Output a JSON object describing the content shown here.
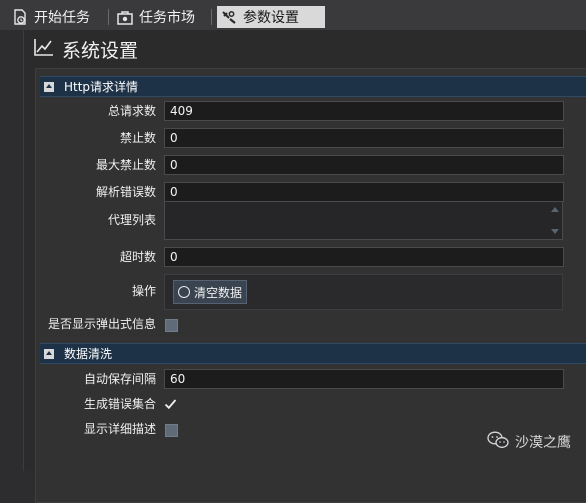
{
  "tabs": [
    {
      "label": "开始任务",
      "icon": "start-task-icon"
    },
    {
      "label": "任务市场",
      "icon": "task-market-icon"
    },
    {
      "label": "参数设置",
      "icon": "settings-icon",
      "active": true
    }
  ],
  "page": {
    "title": "系统设置",
    "title_icon": "chart-line-icon"
  },
  "sections": {
    "http": {
      "title": "Http请求详情",
      "total_requests_label": "总请求数",
      "total_requests_value": "409",
      "banned_label": "禁止数",
      "banned_value": "0",
      "max_banned_label": "最大禁止数",
      "max_banned_value": "0",
      "parse_errors_label": "解析错误数",
      "parse_errors_value": "0",
      "proxy_list_label": "代理列表",
      "timeouts_label": "超时数",
      "timeouts_value": "0",
      "action_label": "操作",
      "clear_button_label": "清空数据",
      "show_popup_label": "是否显示弹出式信息",
      "show_popup_checked": false
    },
    "cleaning": {
      "title": "数据清洗",
      "autosave_label": "自动保存间隔",
      "autosave_value": "60",
      "generate_errors_label": "生成错误集合",
      "generate_errors_checked": true,
      "show_details_label": "显示详细描述",
      "show_details_checked": false
    }
  },
  "watermark": {
    "text": "沙漠之鹰",
    "icon": "wechat-icon"
  },
  "colors": {
    "background": "#2d2d30",
    "section_header": "#1e3247",
    "input_bg": "#1c1c1c",
    "active_tab": "#d9d9d9"
  }
}
